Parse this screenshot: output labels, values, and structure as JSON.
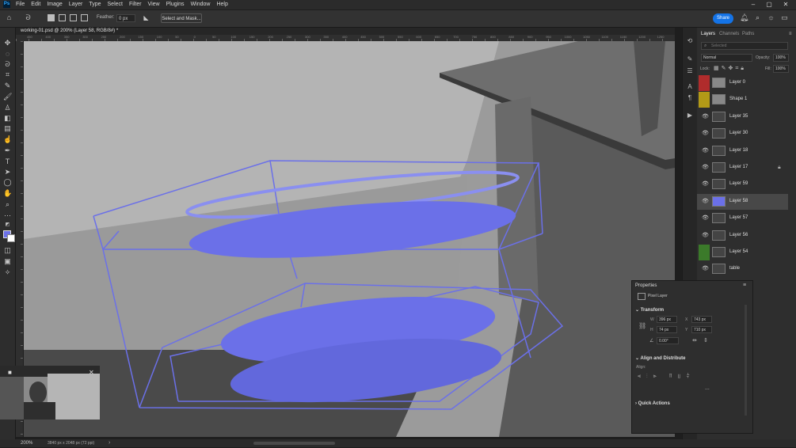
{
  "app": {
    "logo": "Ps"
  },
  "menu": [
    "File",
    "Edit",
    "Image",
    "Layer",
    "Type",
    "Select",
    "Filter",
    "View",
    "Plugins",
    "Window",
    "Help"
  ],
  "options_bar": {
    "feather_label": "Feather:",
    "feather_value": "0 px",
    "select_and_mask": "Select and Mask...",
    "share": "Share"
  },
  "document": {
    "tab_title": "working-01.psd @ 200% (Layer 58, RGB/8#) *",
    "ruler_ticks": [
      "450",
      "400",
      "350",
      "300",
      "250",
      "200",
      "150",
      "100",
      "50",
      "0",
      "50",
      "100",
      "150",
      "200",
      "250",
      "300",
      "350",
      "400",
      "450",
      "500",
      "550",
      "600",
      "650",
      "700",
      "750",
      "800",
      "850",
      "900",
      "950",
      "1000",
      "1050",
      "1100",
      "1150",
      "1200",
      "1250"
    ]
  },
  "layers_panel": {
    "tabs": [
      "Layers",
      "Channels",
      "Paths"
    ],
    "filter_placeholder": "Selected",
    "blend_mode": "Normal",
    "opacity_label": "Opacity:",
    "opacity_value": "100%",
    "lock_label": "Lock:",
    "fill_label": "Fill:",
    "fill_value": "100%",
    "layers": [
      {
        "name": "Layer 0",
        "visible": false,
        "tag_color": "#b02c2c",
        "selected": false,
        "locked": false
      },
      {
        "name": "Shape 1",
        "visible": false,
        "tag_color": "#b39a17",
        "selected": false,
        "locked": false
      },
      {
        "name": "Layer 35",
        "visible": true,
        "tag_color": "",
        "selected": false,
        "locked": false
      },
      {
        "name": "Layer 30",
        "visible": true,
        "tag_color": "",
        "selected": false,
        "locked": false
      },
      {
        "name": "Layer 18",
        "visible": true,
        "tag_color": "",
        "selected": false,
        "locked": false
      },
      {
        "name": "Layer 17",
        "visible": true,
        "tag_color": "",
        "selected": false,
        "locked": true
      },
      {
        "name": "Layer 59",
        "visible": true,
        "tag_color": "",
        "selected": false,
        "locked": false
      },
      {
        "name": "Layer 58",
        "visible": true,
        "tag_color": "",
        "selected": true,
        "locked": false
      },
      {
        "name": "Layer 57",
        "visible": true,
        "tag_color": "",
        "selected": false,
        "locked": false
      },
      {
        "name": "Layer 56",
        "visible": true,
        "tag_color": "",
        "selected": false,
        "locked": false
      },
      {
        "name": "Layer 54",
        "visible": false,
        "tag_color": "#3b7a2a",
        "selected": false,
        "locked": false
      },
      {
        "name": "table",
        "visible": true,
        "tag_color": "",
        "selected": false,
        "locked": false
      }
    ]
  },
  "properties": {
    "title": "Properties",
    "kind": "Pixel Layer",
    "transform_heading": "Transform",
    "w_label": "W",
    "w_value": "396 px",
    "h_label": "H",
    "h_value": "74 px",
    "x_label": "X",
    "x_value": "743 px",
    "y_label": "Y",
    "y_value": "710 px",
    "angle_value": "0.00°",
    "align_heading": "Align and Distribute",
    "align_label": "Align:",
    "more": "...",
    "quick_actions": "Quick Actions"
  },
  "status": {
    "zoom": "200%",
    "doc_size": "3840 px x 2048 px (72 ppi)"
  },
  "colors": {
    "foreground": "#6b70e8",
    "background": "#ffffff",
    "accent": "#1473e6"
  }
}
